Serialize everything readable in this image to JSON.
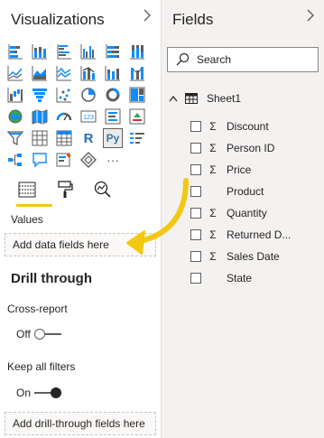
{
  "visualizations": {
    "title": "Visualizations",
    "collapse_icon": "chevron-right-icon",
    "icons": [
      "stacked-bar-chart-icon",
      "stacked-column-chart-icon",
      "clustered-bar-chart-icon",
      "clustered-column-chart-icon",
      "100-stacked-bar-chart-icon",
      "100-stacked-column-chart-icon",
      "line-chart-icon",
      "area-chart-icon",
      "stacked-area-chart-icon",
      "line-clustered-column-chart-icon",
      "line-stacked-column-chart-icon",
      "ribbon-chart-icon",
      "waterfall-chart-icon",
      "funnel-chart-icon",
      "scatter-chart-icon",
      "pie-chart-icon",
      "donut-chart-icon",
      "treemap-icon",
      "map-icon",
      "filled-map-icon",
      "gauge-icon",
      "card-icon",
      "multi-row-card-icon",
      "kpi-icon",
      "slicer-icon",
      "table-icon",
      "matrix-icon",
      "r-visual-icon",
      "python-visual-icon",
      "key-influencers-icon",
      "decomposition-tree-icon",
      "qna-icon",
      "smart-narrative-icon",
      "power-apps-icon",
      "more-visuals-icon"
    ],
    "r_label": "R",
    "py_label": "Py",
    "more_label": "···",
    "tabs": [
      "fields-tab-icon",
      "format-paint-roller-icon",
      "analytics-magnifier-icon"
    ],
    "values_label": "Values",
    "values_placeholder": "Add data fields here",
    "drill_title": "Drill through",
    "cross_report_label": "Cross-report",
    "cross_report_state": "Off",
    "keep_filters_label": "Keep all filters",
    "keep_filters_state": "On",
    "drill_placeholder": "Add drill-through fields here",
    "accent_color": "#f2c811"
  },
  "fields": {
    "title": "Fields",
    "collapse_icon": "chevron-right-icon",
    "search_placeholder": "Search",
    "table_name": "Sheet1",
    "items": [
      {
        "name": "Discount",
        "sigma": true
      },
      {
        "name": "Person ID",
        "sigma": true
      },
      {
        "name": "Price",
        "sigma": true
      },
      {
        "name": "Product",
        "sigma": false
      },
      {
        "name": "Quantity",
        "sigma": true
      },
      {
        "name": "Returned D...",
        "sigma": true
      },
      {
        "name": "Sales Date",
        "sigma": true
      },
      {
        "name": "State",
        "sigma": false
      }
    ]
  },
  "sigma_symbol": "Σ"
}
